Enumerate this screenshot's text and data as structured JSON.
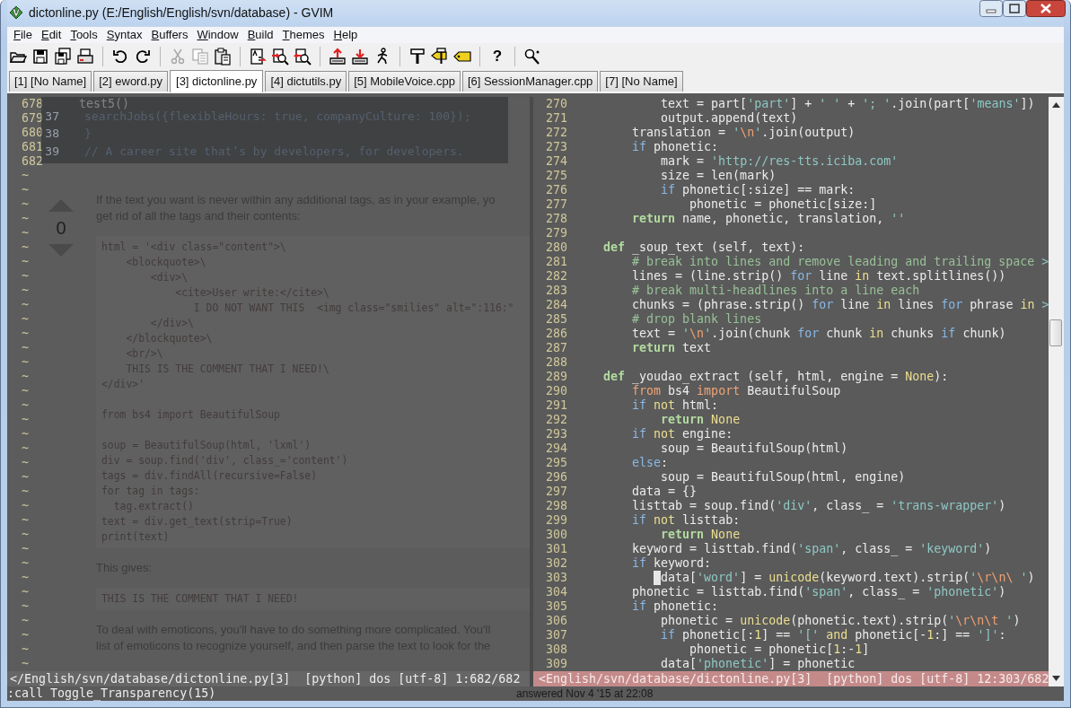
{
  "window": {
    "title": "dictonline.py (E:/English/English/svn/database) - GVIM"
  },
  "menu": [
    "File",
    "Edit",
    "Tools",
    "Syntax",
    "Buffers",
    "Window",
    "Build",
    "Themes",
    "Help"
  ],
  "toolbar": [
    [
      {
        "kind": "open",
        "disabled": false
      },
      {
        "kind": "save",
        "disabled": false
      },
      {
        "kind": "save-all",
        "disabled": false
      },
      {
        "kind": "print",
        "disabled": false
      }
    ],
    [
      {
        "kind": "undo",
        "disabled": false
      },
      {
        "kind": "redo",
        "disabled": false
      }
    ],
    [
      {
        "kind": "cut",
        "disabled": true
      },
      {
        "kind": "copy",
        "disabled": true
      },
      {
        "kind": "paste",
        "disabled": false
      }
    ],
    [
      {
        "kind": "replace",
        "disabled": false
      },
      {
        "kind": "find-next",
        "disabled": false
      },
      {
        "kind": "find-prev",
        "disabled": false
      }
    ],
    [
      {
        "kind": "load-session",
        "disabled": false
      },
      {
        "kind": "save-session",
        "disabled": false
      },
      {
        "kind": "run-script",
        "disabled": false
      }
    ],
    [
      {
        "kind": "make",
        "disabled": false
      },
      {
        "kind": "build-tags",
        "disabled": false
      },
      {
        "kind": "jump-tag",
        "disabled": false
      }
    ],
    [
      {
        "kind": "help",
        "disabled": false,
        "glyph": "?"
      }
    ],
    [
      {
        "kind": "find-help",
        "disabled": false
      }
    ]
  ],
  "tabs": [
    {
      "label": "[1] [No Name]",
      "selected": false
    },
    {
      "label": "[2] eword.py",
      "selected": false
    },
    {
      "label": "[3] dictonline.py",
      "selected": true
    },
    {
      "label": "[4] dictutils.py",
      "selected": false
    },
    {
      "label": "[5] MobileVoice.cpp",
      "selected": false
    },
    {
      "label": "[6] SessionManager.cpp",
      "selected": false
    },
    {
      "label": "[7] [No Name]",
      "selected": false
    }
  ],
  "panes": [
    {
      "active": false,
      "status": "</English/svn/database/dictonline.py[3]  [python] dos [utf-8] 1:682/682",
      "lines": [
        {
          "number": "678",
          "tokens": [
            {
              "kind": "plain",
              "text": "    test5()"
            }
          ]
        },
        {
          "number": "679"
        },
        {
          "number": "680"
        },
        {
          "number": "681"
        },
        {
          "number": "682"
        }
      ],
      "filler": [
        "~",
        "~",
        "~",
        "~",
        "~",
        "~",
        "~",
        "~",
        "~",
        "~",
        "~",
        "~",
        "~",
        "~",
        "~",
        "~",
        "~",
        "~",
        "~",
        "~",
        "~",
        "~",
        "~",
        "~",
        "~",
        "~",
        "~",
        "~",
        "~",
        "~",
        "~",
        "~",
        "~",
        "~",
        "~"
      ]
    },
    {
      "active": true,
      "status": "<English/svn/database/dictonline.py[3]  [python] dos [utf-8] 12:303/682",
      "lines": [
        {
          "number": "270",
          "tokens": [
            {
              "kind": "plain",
              "text": "            text = part["
            },
            {
              "kind": "string",
              "text": "'part'"
            },
            {
              "kind": "plain",
              "text": "] + "
            },
            {
              "kind": "string",
              "text": "' '"
            },
            {
              "kind": "plain",
              "text": " + "
            },
            {
              "kind": "string",
              "text": "'; '"
            },
            {
              "kind": "plain",
              "text": ".join(part["
            },
            {
              "kind": "string",
              "text": "'means'"
            },
            {
              "kind": "plain",
              "text": "])"
            }
          ]
        },
        {
          "number": "271",
          "tokens": [
            {
              "kind": "plain",
              "text": "            output.append(text)"
            }
          ]
        },
        {
          "number": "272",
          "tokens": [
            {
              "kind": "plain",
              "text": "        translation = "
            },
            {
              "kind": "string",
              "text": "'"
            },
            {
              "kind": "escape",
              "text": "\\n"
            },
            {
              "kind": "string",
              "text": "'"
            },
            {
              "kind": "plain",
              "text": ".join(output)"
            }
          ]
        },
        {
          "number": "273",
          "tokens": [
            {
              "kind": "keyword",
              "text": "        if"
            },
            {
              "kind": "plain",
              "text": " phonetic:"
            }
          ]
        },
        {
          "number": "274",
          "tokens": [
            {
              "kind": "plain",
              "text": "            mark = "
            },
            {
              "kind": "string",
              "text": "'http://res-tts.iciba.com'"
            }
          ]
        },
        {
          "number": "275",
          "tokens": [
            {
              "kind": "plain",
              "text": "            size = len(mark)"
            }
          ]
        },
        {
          "number": "276",
          "tokens": [
            {
              "kind": "keyword",
              "text": "            if"
            },
            {
              "kind": "plain",
              "text": " phonetic[:size] == mark:"
            }
          ]
        },
        {
          "number": "277",
          "tokens": [
            {
              "kind": "plain",
              "text": "                phonetic = phonetic[size:]"
            }
          ]
        },
        {
          "number": "278",
          "tokens": [
            {
              "kind": "statement",
              "text": "        return"
            },
            {
              "kind": "plain",
              "text": " name, phonetic, translation, "
            },
            {
              "kind": "string",
              "text": "''"
            }
          ]
        },
        {
          "number": "279"
        },
        {
          "number": "280",
          "tokens": [
            {
              "kind": "statement",
              "text": "    def"
            },
            {
              "kind": "plain",
              "text": " _soup_text (self, text):"
            }
          ]
        },
        {
          "number": "281",
          "tokens": [
            {
              "kind": "comment",
              "text": "        # break into lines and remove leading and trailing space"
            },
            {
              "kind": "overflow",
              "text": " >"
            }
          ]
        },
        {
          "number": "282",
          "tokens": [
            {
              "kind": "plain",
              "text": "        lines = (line.strip() "
            },
            {
              "kind": "keyword",
              "text": "for"
            },
            {
              "kind": "plain",
              "text": " line "
            },
            {
              "kind": "operator",
              "text": "in"
            },
            {
              "kind": "plain",
              "text": " text.splitlines())"
            }
          ]
        },
        {
          "number": "283",
          "tokens": [
            {
              "kind": "comment",
              "text": "        # break multi-headlines into a line each"
            }
          ]
        },
        {
          "number": "284",
          "tokens": [
            {
              "kind": "plain",
              "text": "        chunks = (phrase.strip() "
            },
            {
              "kind": "keyword",
              "text": "for"
            },
            {
              "kind": "plain",
              "text": " line "
            },
            {
              "kind": "operator",
              "text": "in"
            },
            {
              "kind": "plain",
              "text": " lines "
            },
            {
              "kind": "keyword",
              "text": "for"
            },
            {
              "kind": "plain",
              "text": " phrase "
            },
            {
              "kind": "operator",
              "text": "in"
            },
            {
              "kind": "overflow",
              "text": " >"
            }
          ]
        },
        {
          "number": "285",
          "tokens": [
            {
              "kind": "comment",
              "text": "        # drop blank lines"
            }
          ]
        },
        {
          "number": "286",
          "tokens": [
            {
              "kind": "plain",
              "text": "        text = "
            },
            {
              "kind": "string",
              "text": "'"
            },
            {
              "kind": "escape",
              "text": "\\n"
            },
            {
              "kind": "string",
              "text": "'"
            },
            {
              "kind": "plain",
              "text": ".join(chunk "
            },
            {
              "kind": "keyword",
              "text": "for"
            },
            {
              "kind": "plain",
              "text": " chunk "
            },
            {
              "kind": "operator",
              "text": "in"
            },
            {
              "kind": "plain",
              "text": " chunks "
            },
            {
              "kind": "keyword",
              "text": "if"
            },
            {
              "kind": "plain",
              "text": " chunk)"
            }
          ]
        },
        {
          "number": "287",
          "tokens": [
            {
              "kind": "statement",
              "text": "        return"
            },
            {
              "kind": "plain",
              "text": " text"
            }
          ]
        },
        {
          "number": "288"
        },
        {
          "number": "289",
          "tokens": [
            {
              "kind": "statement",
              "text": "    def"
            },
            {
              "kind": "plain",
              "text": " _youdao_extract (self, html, engine = "
            },
            {
              "kind": "operator",
              "text": "None"
            },
            {
              "kind": "plain",
              "text": "):"
            }
          ]
        },
        {
          "number": "290",
          "tokens": [
            {
              "kind": "import",
              "text": "        from"
            },
            {
              "kind": "plain",
              "text": " bs4 "
            },
            {
              "kind": "import",
              "text": "import"
            },
            {
              "kind": "plain",
              "text": " BeautifulSoup"
            }
          ]
        },
        {
          "number": "291",
          "tokens": [
            {
              "kind": "keyword",
              "text": "        if"
            },
            {
              "kind": "operator",
              "text": " not"
            },
            {
              "kind": "plain",
              "text": " html:"
            }
          ]
        },
        {
          "number": "292",
          "tokens": [
            {
              "kind": "statement",
              "text": "            return"
            },
            {
              "kind": "operator",
              "text": " None"
            }
          ]
        },
        {
          "number": "293",
          "tokens": [
            {
              "kind": "keyword",
              "text": "        if"
            },
            {
              "kind": "operator",
              "text": " not"
            },
            {
              "kind": "plain",
              "text": " engine:"
            }
          ]
        },
        {
          "number": "294",
          "tokens": [
            {
              "kind": "plain",
              "text": "            soup = BeautifulSoup(html)"
            }
          ]
        },
        {
          "number": "295",
          "tokens": [
            {
              "kind": "keyword",
              "text": "        else"
            },
            {
              "kind": "plain",
              "text": ":"
            }
          ]
        },
        {
          "number": "296",
          "tokens": [
            {
              "kind": "plain",
              "text": "            soup = BeautifulSoup(html, engine)"
            }
          ]
        },
        {
          "number": "297",
          "tokens": [
            {
              "kind": "plain",
              "text": "        data = {}"
            }
          ]
        },
        {
          "number": "298",
          "tokens": [
            {
              "kind": "plain",
              "text": "        listtab = soup.find("
            },
            {
              "kind": "string",
              "text": "'div'"
            },
            {
              "kind": "plain",
              "text": ", class_ = "
            },
            {
              "kind": "string",
              "text": "'trans-wrapper'"
            },
            {
              "kind": "plain",
              "text": ")"
            }
          ]
        },
        {
          "number": "299",
          "tokens": [
            {
              "kind": "keyword",
              "text": "        if"
            },
            {
              "kind": "operator",
              "text": " not"
            },
            {
              "kind": "plain",
              "text": " listtab:"
            }
          ]
        },
        {
          "number": "300",
          "tokens": [
            {
              "kind": "statement",
              "text": "            return"
            },
            {
              "kind": "operator",
              "text": " None"
            }
          ]
        },
        {
          "number": "301",
          "tokens": [
            {
              "kind": "plain",
              "text": "        keyword = listtab.find("
            },
            {
              "kind": "string",
              "text": "'span'"
            },
            {
              "kind": "plain",
              "text": ", class_ = "
            },
            {
              "kind": "string",
              "text": "'keyword'"
            },
            {
              "kind": "plain",
              "text": ")"
            }
          ]
        },
        {
          "number": "302",
          "tokens": [
            {
              "kind": "keyword",
              "text": "        if"
            },
            {
              "kind": "plain",
              "text": " keyword:"
            }
          ]
        },
        {
          "number": "303",
          "cursor": true,
          "tokens": [
            {
              "kind": "plain",
              "text": "            data["
            },
            {
              "kind": "string",
              "text": "'word'"
            },
            {
              "kind": "plain",
              "text": "] = "
            },
            {
              "kind": "operator",
              "text": "unicode"
            },
            {
              "kind": "plain",
              "text": "(keyword.text).strip("
            },
            {
              "kind": "string",
              "text": "'"
            },
            {
              "kind": "escape",
              "text": "\\r\\n\\ "
            },
            {
              "kind": "string",
              "text": "'"
            },
            {
              "kind": "plain",
              "text": ")"
            }
          ]
        },
        {
          "number": "304",
          "tokens": [
            {
              "kind": "plain",
              "text": "        phonetic = listtab.find("
            },
            {
              "kind": "string",
              "text": "'span'"
            },
            {
              "kind": "plain",
              "text": ", class_ = "
            },
            {
              "kind": "string",
              "text": "'phonetic'"
            },
            {
              "kind": "plain",
              "text": ")"
            }
          ]
        },
        {
          "number": "305",
          "tokens": [
            {
              "kind": "keyword",
              "text": "        if"
            },
            {
              "kind": "plain",
              "text": " phonetic:"
            }
          ]
        },
        {
          "number": "306",
          "tokens": [
            {
              "kind": "plain",
              "text": "            phonetic = "
            },
            {
              "kind": "operator",
              "text": "unicode"
            },
            {
              "kind": "plain",
              "text": "(phonetic.text).strip("
            },
            {
              "kind": "string",
              "text": "'"
            },
            {
              "kind": "escape",
              "text": "\\r\\n\\t"
            },
            {
              "kind": "string",
              "text": " '"
            },
            {
              "kind": "plain",
              "text": ")"
            }
          ]
        },
        {
          "number": "307",
          "tokens": [
            {
              "kind": "keyword",
              "text": "            if"
            },
            {
              "kind": "plain",
              "text": " phonetic[:"
            },
            {
              "kind": "number",
              "text": "1"
            },
            {
              "kind": "plain",
              "text": "] == "
            },
            {
              "kind": "string",
              "text": "'['"
            },
            {
              "kind": "operator",
              "text": " and"
            },
            {
              "kind": "plain",
              "text": " phonetic[-"
            },
            {
              "kind": "number",
              "text": "1"
            },
            {
              "kind": "plain",
              "text": ":] == "
            },
            {
              "kind": "string",
              "text": "']'"
            },
            {
              "kind": "plain",
              "text": ":"
            }
          ]
        },
        {
          "number": "308",
          "tokens": [
            {
              "kind": "plain",
              "text": "                phonetic = phonetic["
            },
            {
              "kind": "number",
              "text": "1"
            },
            {
              "kind": "plain",
              "text": ":-"
            },
            {
              "kind": "number",
              "text": "1"
            },
            {
              "kind": "plain",
              "text": "]"
            }
          ]
        },
        {
          "number": "309",
          "tokens": [
            {
              "kind": "plain",
              "text": "            data["
            },
            {
              "kind": "string",
              "text": "'phonetic'"
            },
            {
              "kind": "plain",
              "text": "] = phonetic"
            }
          ]
        }
      ]
    }
  ],
  "command_line": ":call Toggle_Transparency(15)",
  "background_page": {
    "banner": [
      {
        "number": "37",
        "text": "searchJobs({flexibleHours: true, companyCulture: 100});"
      },
      {
        "number": "38",
        "text": "}"
      },
      {
        "number": "39",
        "text": "// A career site that’s by developers, for developers."
      }
    ],
    "vote_count": "0",
    "blocks": [
      {
        "kind": "paragraph",
        "lines": [
          "If the text you want is never within any additional tags, as in your example, yo",
          "get rid of all the tags and their contents:"
        ]
      },
      {
        "kind": "code",
        "groups": [
          [
            "html = '<div class=\"content\">\\",
            "    <blockquote>\\",
            "        <div>\\",
            "            <cite>User write:</cite>\\",
            "               I DO NOT WANT THIS  <img class=\"smilies\" alt=\":116:\"",
            "        </div>\\",
            "    </blockquote>\\",
            "    <br/>\\",
            "    THIS IS THE COMMENT THAT I NEED!\\",
            "</div>'"
          ],
          [
            "from bs4 import BeautifulSoup"
          ],
          [
            "soup = BeautifulSoup(html, 'lxml')",
            "div = soup.find('div', class_='content')",
            "tags = div.findAll(recursive=False)",
            "for tag in tags:",
            "  tag.extract()",
            "text = div.get_text(strip=True)",
            "print(text)"
          ]
        ]
      },
      {
        "kind": "paragraph",
        "lines": [
          "This gives:"
        ]
      },
      {
        "kind": "code",
        "groups": [
          [
            "THIS IS THE COMMENT THAT I NEED!"
          ]
        ]
      },
      {
        "kind": "paragraph",
        "lines": [
          "To deal with emoticons, you'll have to do something more complicated. You'll",
          "list of emoticons to recognize yourself, and then parse the text to look for the"
        ]
      }
    ],
    "answered": "answered Nov 4 '15 at 22:08"
  }
}
